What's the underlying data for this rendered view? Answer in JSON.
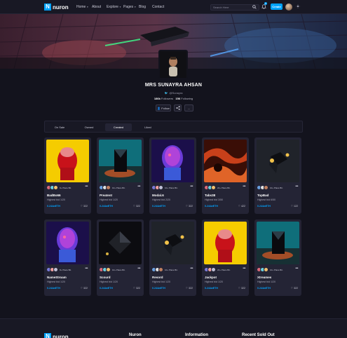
{
  "header": {
    "logo_mark": "N",
    "logo_text": "nuron",
    "nav": [
      {
        "label": "Home",
        "caret": true
      },
      {
        "label": "About",
        "caret": false
      },
      {
        "label": "Explore",
        "caret": true
      },
      {
        "label": "Pages",
        "caret": true
      },
      {
        "label": "Blog",
        "caret": false
      },
      {
        "label": "Contact",
        "caret": false
      }
    ],
    "search_placeholder": "Search Here",
    "notification_count": "6",
    "create_label": "Create",
    "icons": [
      "search-icon",
      "bell-icon",
      "user-avatar",
      "theme-toggle-icon"
    ]
  },
  "profile": {
    "name": "MRS SUNAYRA AHSAN",
    "handle": "@Sunayra",
    "followers_count": "186k",
    "followers_label": "Followers",
    "following_count": "156",
    "following_label": "Following",
    "follow_label": "Follow",
    "share_icon": "share-icon",
    "more_label": "..."
  },
  "tabs": [
    {
      "label": "On Sale",
      "active": false
    },
    {
      "label": "Owned",
      "active": false
    },
    {
      "label": "Created",
      "active": true
    },
    {
      "label": "Liked",
      "active": false
    }
  ],
  "cards": [
    {
      "name": "BadBo66",
      "place": "9+ Place Bit.",
      "bid": "Highest bid 1/20",
      "price": "0.244wETH",
      "likes": "322",
      "art": "red-bust-yellow"
    },
    {
      "name": "Preatent",
      "place": "10+ Place Bit.",
      "bid": "Highest bid 1/20",
      "price": "0.244wETH",
      "likes": "322",
      "art": "prism-cyan"
    },
    {
      "name": "Modal.6",
      "place": "10+ Place Bit.",
      "bid": "Highest bid 2/20",
      "price": "0.244wETH",
      "likes": "322",
      "art": "neon-bust"
    },
    {
      "name": "Tabs38",
      "place": "22+ Place Bit.",
      "bid": "Highest bid 3/50",
      "price": "0.244wETH",
      "likes": "422",
      "art": "lava-swirl"
    },
    {
      "name": "TopBad",
      "place": "10+ Place Bit.",
      "bid": "Highest bid 6/50",
      "price": "0.244wETH",
      "likes": "122",
      "art": "dark-cube"
    },
    {
      "name": "NameStroam",
      "place": "8+ Place Bit.",
      "bid": "Highest bid 1/20",
      "price": "0.244wETH",
      "likes": "322",
      "art": "neon-bust"
    },
    {
      "name": "Scourd",
      "place": "10+ Place Bit.",
      "bid": "Highest bid 1/20",
      "price": "0.244wETH",
      "likes": "322",
      "art": "dark-diamond"
    },
    {
      "name": "Resord",
      "place": "10+ Place Bit.",
      "bid": "Highest bid 1/20",
      "price": "0.244wETH",
      "likes": "322",
      "art": "dark-cube"
    },
    {
      "name": "Jackpot",
      "place": "22+ Place Bit.",
      "bid": "Highest bid 1/20",
      "price": "0.244wETH",
      "likes": "322",
      "art": "red-bust-yellow"
    },
    {
      "name": "Xtreames",
      "place": "10+ Place Bit.",
      "bid": "Highest bid 1/20",
      "price": "0.244wETH",
      "likes": "322",
      "art": "prism-cyan"
    }
  ],
  "footer": {
    "logo_text": "nuron",
    "col1": "Nuron",
    "col2": "Information",
    "col3": "Recent Sold Out"
  },
  "colors": {
    "accent": "#00a3ff",
    "bg": "#13131d",
    "card": "#242435"
  }
}
